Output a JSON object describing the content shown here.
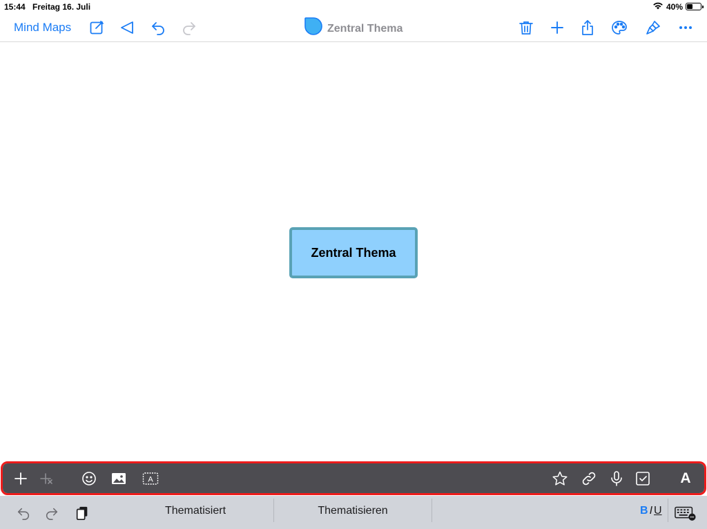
{
  "status": {
    "time": "15:44",
    "date": "Freitag 16. Juli",
    "battery_percent": "40%",
    "battery_level": 0.4
  },
  "nav": {
    "back_label": "Mind Maps",
    "title": "Zentral Thema",
    "accent_color": "#1a7cf5",
    "left_icons": [
      "compose-icon",
      "send-icon",
      "undo-icon",
      "redo-icon"
    ],
    "right_icons": [
      "trash-icon",
      "plus-icon",
      "share-icon",
      "palette-icon",
      "brush-icon",
      "more-icon"
    ]
  },
  "canvas": {
    "central_topic": {
      "label": "Zentral Thema",
      "fill_color": "#8fd0fd",
      "border_color": "#59a2b5"
    }
  },
  "accessory_toolbar": {
    "left_icons": [
      "add-topic-icon",
      "add-subtopic-icon",
      "emoji-icon",
      "image-icon",
      "label-icon"
    ],
    "right_icons": [
      "star-icon",
      "link-icon",
      "microphone-icon",
      "checkbox-icon",
      "text-style-icon"
    ],
    "text_style_label": "A",
    "highlight_color": "#ee1c1c"
  },
  "keyboard_bar": {
    "suggestions": [
      "Thematisiert",
      "Thematisieren"
    ],
    "format": {
      "bold": "B",
      "italic": "I",
      "underline": "U"
    }
  }
}
